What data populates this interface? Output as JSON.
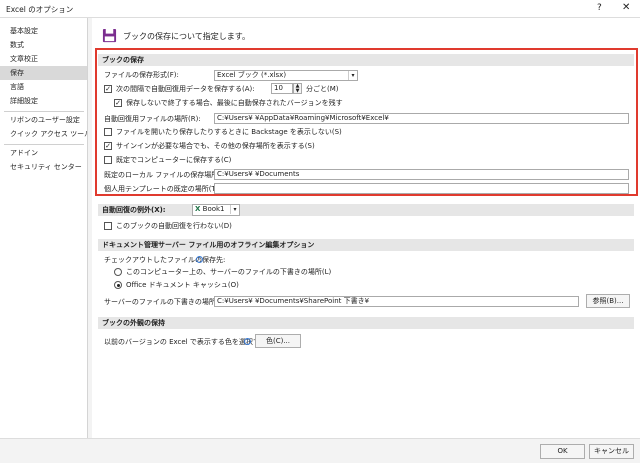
{
  "window": {
    "title": "Excel のオプション",
    "help": "?",
    "close": "✕"
  },
  "sidebar": {
    "items": [
      {
        "label": "基本設定"
      },
      {
        "label": "数式"
      },
      {
        "label": "文章校正"
      },
      {
        "label": "保存"
      },
      {
        "label": "言語"
      },
      {
        "label": "詳細設定"
      },
      {
        "label": "リボンのユーザー設定"
      },
      {
        "label": "クイック アクセス ツール バー"
      },
      {
        "label": "アドイン"
      },
      {
        "label": "セキュリティ センター"
      }
    ],
    "active": "保存"
  },
  "header": {
    "text": "ブックの保存について指定します。"
  },
  "save": {
    "title": "ブックの保存",
    "format_label": "ファイルの保存形式(F):",
    "format_value": "Excel ブック (*.xlsx)",
    "autorecover_label": "次の間隔で自動回復用データを保存する(A):",
    "autorecover_checked": true,
    "autorecover_minutes": "10",
    "minutes_suffix": "分ごと(M)",
    "keep_last_label": "保存しないで終了する場合、最後に自動保存されたバージョンを残す",
    "keep_last_checked": true,
    "autorecover_location_label": "自動回復用ファイルの場所(R):",
    "autorecover_location_value": "C:¥Users¥        ¥AppData¥Roaming¥Microsoft¥Excel¥",
    "backstage_label": "ファイルを開いたり保存したりするときに Backstage を表示しない(S)",
    "backstage_checked": false,
    "signin_label": "サインインが必要な場合でも、その他の保存場所を表示する(S)",
    "signin_checked": true,
    "default_computer_label": "既定でコンピューターに保存する(C)",
    "default_computer_checked": false,
    "local_location_label": "既定のローカル ファイルの保存場所(I):",
    "local_location_value": "C:¥Users¥        ¥Documents",
    "template_label": "個人用テンプレートの既定の場所(T):",
    "template_value": ""
  },
  "autorecover_exceptions": {
    "title": "自動回復の例外(X):",
    "book_value": "Book1",
    "disable_label": "このブックの自動回復を行わない(D)",
    "disable_checked": false
  },
  "offline": {
    "title": "ドキュメント管理サーバー ファイル用のオフライン編集オプション",
    "checkout_label": "チェックアウトしたファイルの保存先:",
    "option1_label": "このコンピューター上の、サーバーのファイルの下書きの場所(L)",
    "option1_selected": false,
    "option2_label": "Office ドキュメント キャッシュ(O)",
    "option2_selected": true,
    "drafts_label": "サーバーのファイルの下書きの場所(V):",
    "drafts_value": "C:¥Users¥        ¥Documents¥SharePoint 下書き¥",
    "browse_label": "参照(B)..."
  },
  "appearance": {
    "title": "ブックの外観の保持",
    "colors_label": "以前のバージョンの Excel で表示する色を選択する:",
    "colors_button": "色(C)..."
  },
  "footer": {
    "ok": "OK",
    "cancel": "キャンセル"
  }
}
